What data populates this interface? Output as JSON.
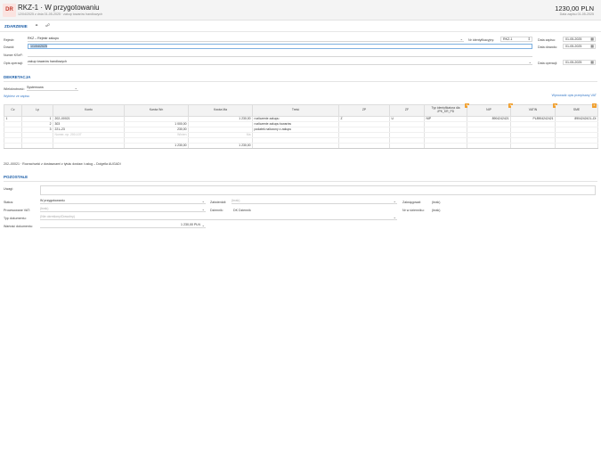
{
  "header": {
    "badge": "DR",
    "title": "RKZ-1 · W przygotowaniu",
    "subtitle": "12/04/2025 z dnia 01-05-2025 · zakup towarów handlowych",
    "amount": "1230,00 PLN",
    "date_note": "Data zapisu 01-05-2025"
  },
  "tabs": {
    "event": "ZDARZENIE",
    "icons": [
      "attach-icon",
      "link-icon"
    ]
  },
  "event_form": {
    "register_label": "Rejestr:",
    "register_value": "RKZ – Rejestr zakupu",
    "identifier_label": "Nr identyfikacyjny:",
    "identifier_value": "RKZ-1",
    "document_label": "Dowód:",
    "document_value": "1/1/04/2025",
    "ksef_label": "Numer KSeF:",
    "ksef_value": "",
    "operation_desc_label": "Opis operacji:",
    "operation_desc_value": "zakup towarów handlowych",
    "entry_date_label": "Data zapisu:",
    "entry_date_value": "01-05-2025",
    "doc_date_label": "Data dowodu:",
    "doc_date_value": "01-05-2025",
    "op_date_label": "Data operacji:",
    "op_date_value": "01-05-2025"
  },
  "decree": {
    "section_title": "DEKRETACJA",
    "mode_label": "Wielokrotność:",
    "mode_value": "Systemowa",
    "add_link": "Wybierz ze zapisu",
    "vat_link": "Wprowadź opis przepisany VAT",
    "columns": [
      "Cz",
      "Lp",
      "Konto",
      "Kwota Wn",
      "Kwota Ma",
      "Treść",
      "ZP",
      "ZF",
      "Typ identyfikatora dla JPK_KR_PD",
      "NIP",
      "VATIN",
      "SME"
    ],
    "rows": [
      {
        "cz": "1",
        "lp": "1",
        "konto": "202–00021",
        "wn": "",
        "ma": "1 230,00",
        "tresc": "rozliczenie zakupu",
        "zp": "Z",
        "zf": "U",
        "typ": "NIP",
        "nip": "8904242421",
        "vatin": "PL8904242421",
        "sme": "8904242421–DI"
      },
      {
        "cz": "",
        "lp": "2",
        "konto": "303",
        "wn": "1 000,00",
        "ma": "",
        "tresc": "rozliczenie zakupu towarów",
        "zp": "",
        "zf": "",
        "typ": "",
        "nip": "",
        "vatin": "",
        "sme": ""
      },
      {
        "cz": "",
        "lp": "3",
        "konto": "221–23",
        "wn": "230,00",
        "ma": "",
        "tresc": "podatek naliczony z zakupu",
        "zp": "",
        "zf": "",
        "typ": "",
        "nip": "",
        "vatin": "",
        "sme": ""
      }
    ],
    "placeholder_row": {
      "konto": "Numer, np. 200-107",
      "wn": "Winien",
      "ma": "Ma"
    },
    "totals": {
      "wn": "1 230,00",
      "ma": "1 230,00"
    },
    "account_note": "202–00021 · Rozrachunki z dostawcami z tytułu dostaw i usług – Dolgella AUGADI"
  },
  "other": {
    "section_title": "POZOSTAŁE",
    "notes_label": "Uwagi:",
    "status_label": "Status:",
    "status_value": "W przygotowaniu",
    "approved_label": "Zatwierdził:",
    "approved_value": "(brak)",
    "booked_label": "Zaksięgował:",
    "booked_value": "(brak)",
    "vat_proc_label": "Procesowane VAT:",
    "vat_proc_value": "(brak)",
    "journal_label": "Dziennik:",
    "journal_value": "DK Dziennik",
    "journal_no_label": "Nr w dzienniku:",
    "journal_no_value": "(brak)",
    "doc_type_label": "Typ dokumentu:",
    "doc_type_placeholder": "(Nie określony/Dowolny)",
    "doc_value_label": "Wartość dokumentu:",
    "doc_value_value": "1 230,00 PLN"
  }
}
